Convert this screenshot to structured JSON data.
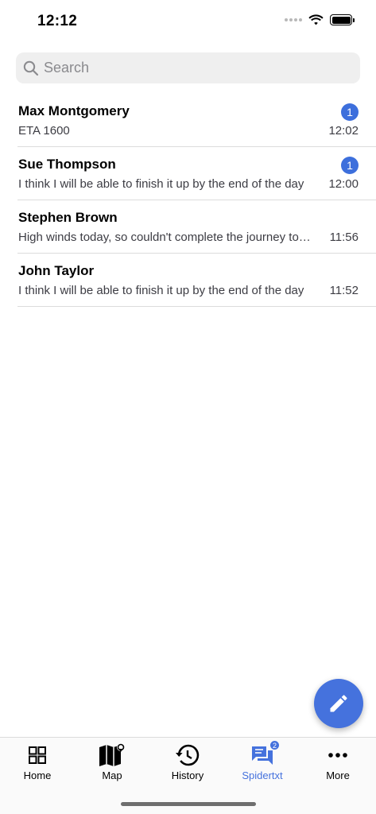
{
  "status_bar": {
    "time": "12:12"
  },
  "search": {
    "placeholder": "Search"
  },
  "chats": [
    {
      "name": "Max Montgomery",
      "preview": "ETA 1600",
      "time": "12:02",
      "unread": "1"
    },
    {
      "name": "Sue Thompson",
      "preview": "I think I will be able to finish it up by the end of the day",
      "time": "12:00",
      "unread": "1"
    },
    {
      "name": "Stephen Brown",
      "preview": "High winds today, so couldn't complete the journey today",
      "time": "11:56",
      "unread": ""
    },
    {
      "name": "John Taylor",
      "preview": "I think I will be able to finish it up by the end of the day",
      "time": "11:52",
      "unread": ""
    }
  ],
  "tabs": [
    {
      "label": "Home",
      "icon": "grid-icon"
    },
    {
      "label": "Map",
      "icon": "map-icon"
    },
    {
      "label": "History",
      "icon": "history-icon"
    },
    {
      "label": "Spidertxt",
      "icon": "chat-icon",
      "badge": "2",
      "active": true
    },
    {
      "label": "More",
      "icon": "more-icon"
    }
  ],
  "colors": {
    "accent": "#4572dd",
    "badge": "#3d6fdc"
  },
  "fab": {
    "icon": "pencil-icon"
  }
}
